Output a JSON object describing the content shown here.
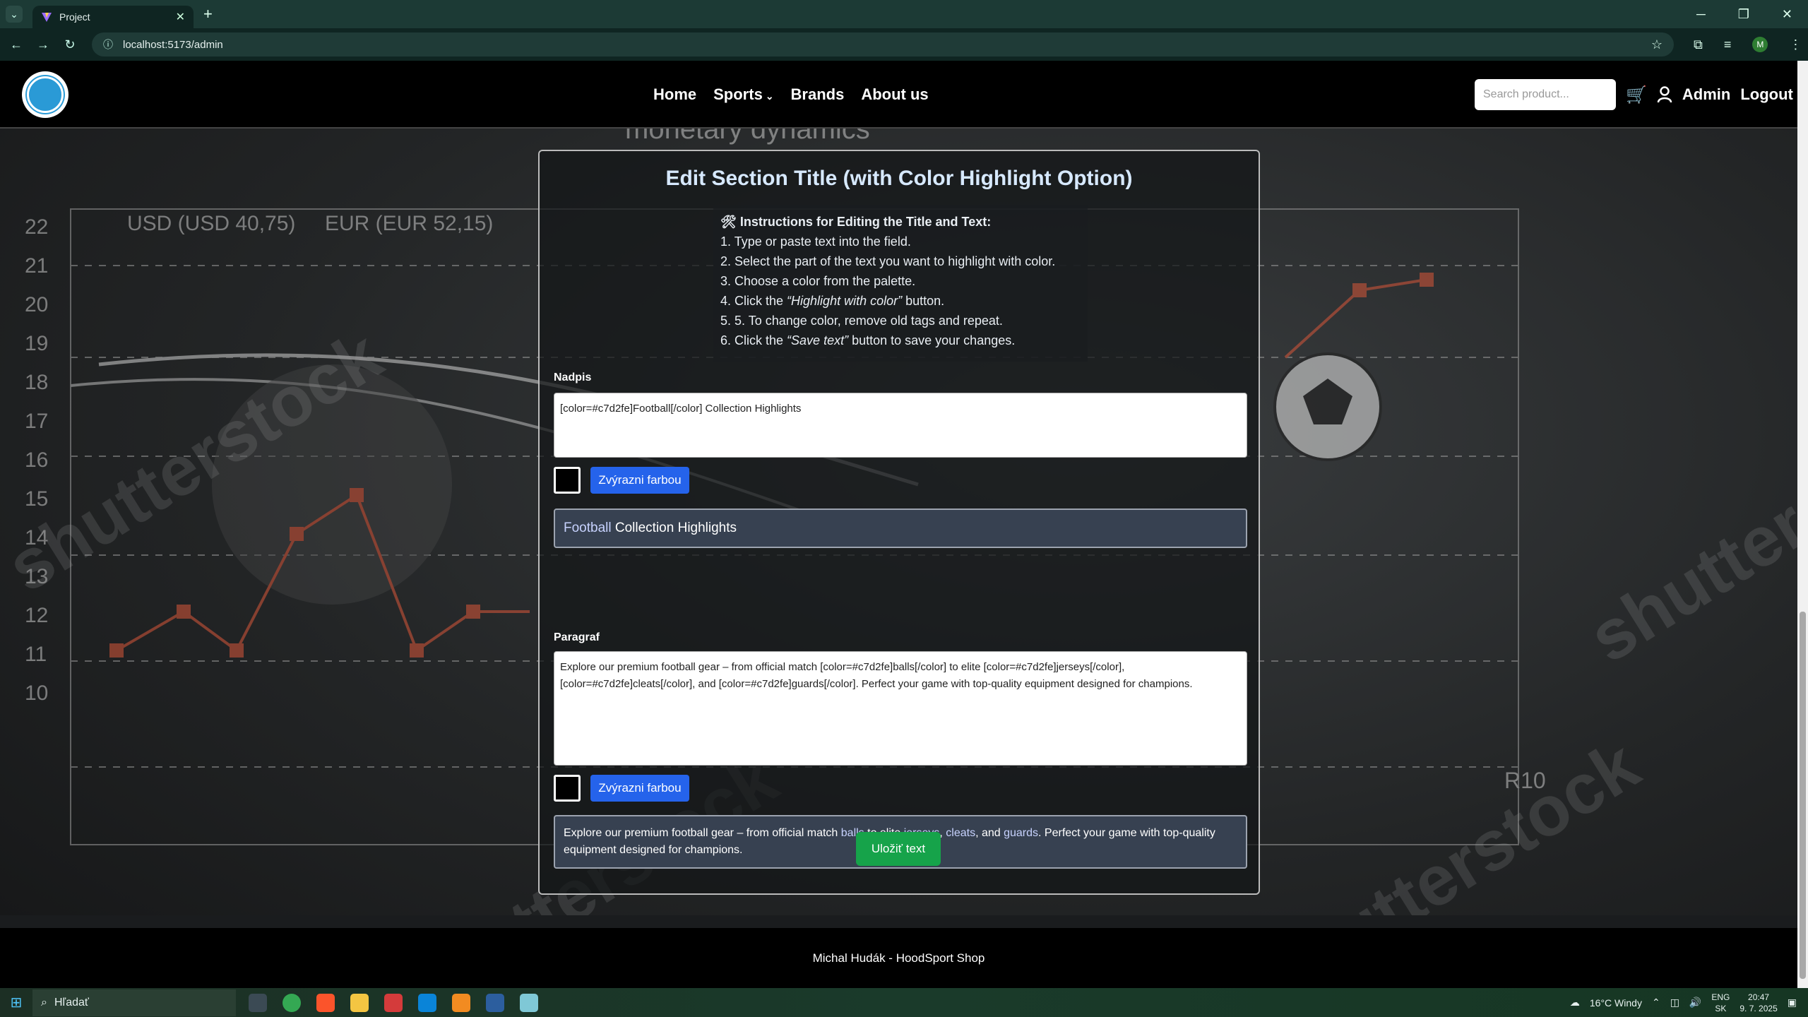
{
  "browser": {
    "tab_title": "Project",
    "url": "localhost:5173/admin",
    "profile_initial": "M"
  },
  "header": {
    "nav": [
      "Home",
      "Sports",
      "Brands",
      "About us"
    ],
    "search_placeholder": "Search product...",
    "admin_label": "Admin",
    "logout_label": "Logout"
  },
  "panel": {
    "title": "Edit Section Title (with Color Highlight Option)",
    "instructions_heading": "Instructions for Editing the Title and Text:",
    "steps": {
      "s1": "1. Type or paste text into the field.",
      "s2": "2. Select the part of the text you want to highlight with color.",
      "s3": "3. Choose a color from the palette.",
      "s4_pre": "4. Click the ",
      "s4_em": "“Highlight with color”",
      "s4_post": " button.",
      "s5": "5. 5. To change color, remove old tags and repeat.",
      "s6_pre": "6. Click the ",
      "s6_em": "“Save text”",
      "s6_post": " button to save your changes."
    },
    "title_label": "Nadpis",
    "title_value": "[color=#c7d2fe]Football[/color] Collection Highlights",
    "highlight_button": "Zvýrazni farbou",
    "title_preview": {
      "hl": "Football",
      "rest": " Collection Highlights"
    },
    "paragraph_label": "Paragraf",
    "paragraph_value": "Explore our premium football gear – from official match [color=#c7d2fe]balls[/color] to elite [color=#c7d2fe]jerseys[/color], [color=#c7d2fe]cleats[/color], and [color=#c7d2fe]guards[/color]. Perfect your game with top-quality equipment designed for champions.",
    "paragraph_preview": {
      "p1": "Explore our premium football gear – from official match ",
      "h1": "balls",
      "p2": " to elite ",
      "h2": "jerseys",
      "p3": ", ",
      "h3": "cleats",
      "p4": ", and ",
      "h4": "guards",
      "p5": ". Perfect your game with top-quality equipment designed for champions."
    },
    "save_button": "Uložiť text",
    "highlight_color": "#c7d2fe"
  },
  "footer": {
    "text": "Michal Hudák - HoodSport Shop"
  },
  "taskbar": {
    "search_placeholder": "Hľadať",
    "weather": "16°C  Windy",
    "lang": "ENG",
    "lang2": "SK",
    "time": "20:47",
    "date": "9. 7. 2025"
  },
  "background": {
    "watermark": "shutterstock",
    "chart_text": {
      "top": "monetary dynamics",
      "usd": "USD (USD 40,75)",
      "eur": "EUR (EUR 52,15)",
      "r10": "R10"
    }
  }
}
